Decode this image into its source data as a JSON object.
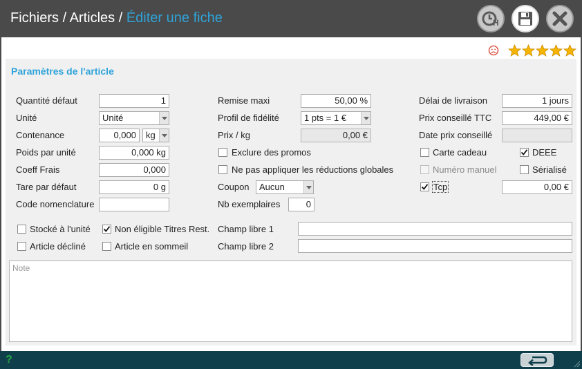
{
  "breadcrumb": {
    "part1": "Fichiers",
    "sep1": " / ",
    "part2": "Articles",
    "sep2": " / ",
    "current": "Éditer une fiche"
  },
  "toolbar": {
    "history_icon": "clock-h-icon",
    "save_icon": "floppy-disk-icon",
    "close_icon": "close-x-icon"
  },
  "rating": {
    "stars": 5,
    "max": 5,
    "mood_icon": "sad-face-icon"
  },
  "section": {
    "title": "Paramètres de l'article"
  },
  "col1": {
    "qte_label": "Quantité défaut",
    "qte_value": "1",
    "unite_label": "Unité",
    "unite_value": "Unité",
    "contenance_label": "Contenance",
    "contenance_value": "0,000",
    "contenance_unit": "kg",
    "poids_label": "Poids par unité",
    "poids_value": "0,000 kg",
    "coeff_label": "Coeff Frais",
    "coeff_value": "0,000",
    "tare_label": "Tare par défaut",
    "tare_value": "0 g",
    "code_label": "Code nomenclature",
    "code_value": ""
  },
  "col2": {
    "remise_label": "Remise maxi",
    "remise_value": "50,00 %",
    "fidelite_label": "Profil de fidélité",
    "fidelite_value": "1 pts = 1 €",
    "prixkg_label": "Prix / kg",
    "prixkg_value": "0,00 €",
    "exclure_label": "Exclure des promos",
    "exclure_checked": false,
    "reductions_label": "Ne pas appliquer les réductions globales",
    "reductions_checked": false,
    "coupon_label": "Coupon",
    "coupon_value": "Aucun",
    "nb_label": "Nb exemplaires",
    "nb_value": "0"
  },
  "col3": {
    "delai_label": "Délai de livraison",
    "delai_value": "1 jours",
    "prix_ttc_label": "Prix conseillé TTC",
    "prix_ttc_value": "449,00 €",
    "date_prix_label": "Date prix conseillé",
    "date_prix_value": "",
    "carte_label": "Carte cadeau",
    "carte_checked": false,
    "deee_label": "DEEE",
    "deee_checked": true,
    "numero_label": "Numéro manuel",
    "numero_checked": false,
    "serialise_label": "Sérialisé",
    "serialise_checked": false,
    "tcp_label": "Tcp",
    "tcp_checked": true,
    "tcp_value": "0,00 €"
  },
  "bottom": {
    "stocke_label": "Stocké à l'unité",
    "stocke_checked": false,
    "non_eligible_label": "Non éligible Titres Rest.",
    "non_eligible_checked": true,
    "decline_label": "Article décliné",
    "decline_checked": false,
    "sommeil_label": "Article en sommeil",
    "sommeil_checked": false,
    "champ1_label": "Champ libre 1",
    "champ1_value": "",
    "champ2_label": "Champ libre 2",
    "champ2_value": ""
  },
  "note": {
    "placeholder": "Note"
  },
  "footer": {
    "help": "?",
    "back_icon": "return-arrow-icon"
  },
  "colors": {
    "accent": "#2fa3d9",
    "titlebar": "#4a4a4a",
    "footer": "#0e3f4a",
    "star": "#f5b400"
  }
}
